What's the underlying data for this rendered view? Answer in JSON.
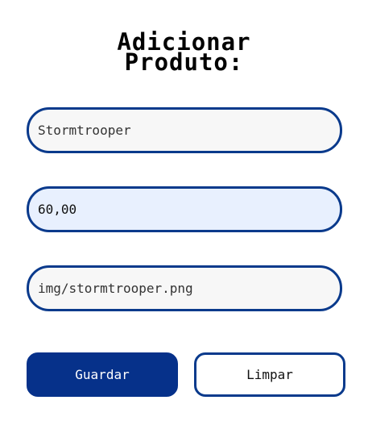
{
  "form": {
    "title_line1": "Adicionar",
    "title_line2": "Produto:",
    "name_value": "Stormtrooper",
    "price_value": "60,00",
    "image_value": "img/stormtrooper.png",
    "submit_label": "Guardar",
    "reset_label": "Limpar"
  },
  "colors": {
    "accent": "#06318a",
    "field_border": "#0a3a8c",
    "field_background": "#f7f7f7",
    "autofill_background": "#e8f0fe"
  }
}
